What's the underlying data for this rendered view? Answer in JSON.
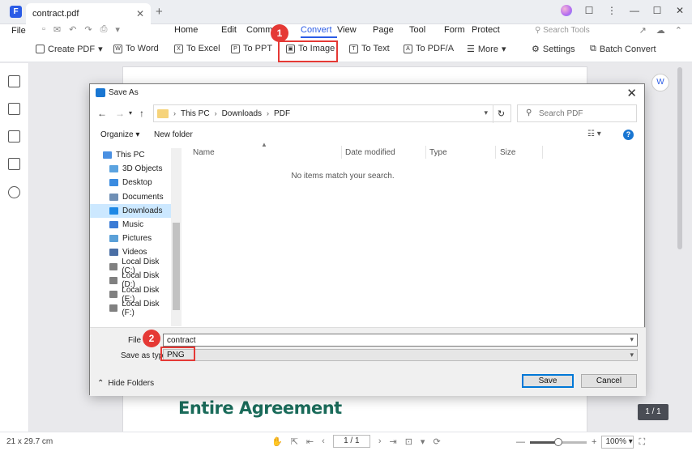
{
  "window": {
    "tab_title": "contract.pdf",
    "tab_close": "✕",
    "new_tab": "+",
    "controls": [
      "▢",
      "—",
      "☐",
      "✕"
    ]
  },
  "menu": {
    "file": "File",
    "tabs": [
      "Home",
      "Edit",
      "Comm",
      "Convert",
      "View",
      "Page",
      "Tool",
      "Form",
      "Protect"
    ],
    "active_tab": "Convert",
    "search_tools": "Search Tools"
  },
  "toolbar": {
    "create_pdf": "Create PDF",
    "to_word": "To Word",
    "to_excel": "To Excel",
    "to_ppt": "To PPT",
    "to_image": "To Image",
    "to_text": "To Text",
    "to_pdfa": "To PDF/A",
    "more": "More",
    "settings": "Settings",
    "batch_convert": "Batch Convert"
  },
  "callouts": {
    "step1": "1",
    "step2": "2"
  },
  "document": {
    "heading": "Entire Agreement",
    "page_indicator": "1 / 1"
  },
  "dialog": {
    "title": "Save As",
    "close": "✕",
    "breadcrumb": [
      "This PC",
      "Downloads",
      "PDF"
    ],
    "search_placeholder": "Search PDF",
    "organize": "Organize",
    "new_folder": "New folder",
    "nav_items": [
      {
        "label": "This PC",
        "icon": "computer-icon",
        "color": "#4a90e2"
      },
      {
        "label": "3D Objects",
        "icon": "cube-icon",
        "color": "#5ba3e0"
      },
      {
        "label": "Desktop",
        "icon": "desktop-icon",
        "color": "#3a8be0"
      },
      {
        "label": "Documents",
        "icon": "document-icon",
        "color": "#6f8fb5"
      },
      {
        "label": "Downloads",
        "icon": "download-icon",
        "color": "#1e88e5"
      },
      {
        "label": "Music",
        "icon": "music-icon",
        "color": "#3a7bd5"
      },
      {
        "label": "Pictures",
        "icon": "picture-icon",
        "color": "#5aa0d8"
      },
      {
        "label": "Videos",
        "icon": "video-icon",
        "color": "#4a6fa5"
      },
      {
        "label": "Local Disk (C:)",
        "icon": "drive-icon",
        "color": "#808080"
      },
      {
        "label": "Local Disk (D:)",
        "icon": "drive-icon",
        "color": "#808080"
      },
      {
        "label": "Local Disk (E:)",
        "icon": "drive-icon",
        "color": "#808080"
      },
      {
        "label": "Local Disk (F:)",
        "icon": "drive-icon",
        "color": "#808080"
      }
    ],
    "selected_nav": "Downloads",
    "columns": [
      "Name",
      "Date modified",
      "Type",
      "Size"
    ],
    "empty_message": "No items match your search.",
    "file_name_label": "File",
    "file_name_value": "contract",
    "save_type_label": "Save as type:",
    "save_type_value": "PNG",
    "hide_folders": "Hide Folders",
    "save_button": "Save",
    "cancel_button": "Cancel"
  },
  "status": {
    "paper_size": "21 x 29.7 cm",
    "page_input": "1 / 1",
    "zoom": "100%",
    "zoom_level": 0.5
  },
  "colors": {
    "accent": "#2b5ce6",
    "callout_red": "#e53935",
    "heading_green": "#1a6b5a"
  }
}
